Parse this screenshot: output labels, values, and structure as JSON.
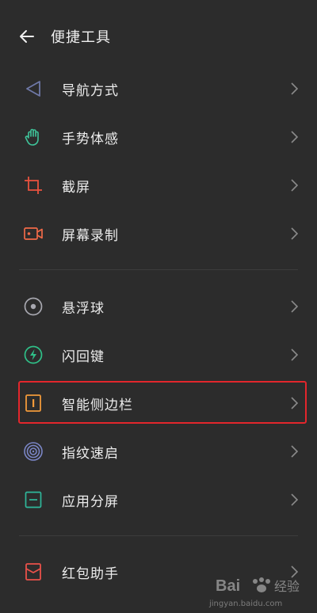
{
  "header": {
    "title": "便捷工具"
  },
  "groups": [
    {
      "items": [
        {
          "label": "导航方式",
          "icon": "navigation-arrow-icon",
          "color": "#6f79a8"
        },
        {
          "label": "手势体感",
          "icon": "hand-gesture-icon",
          "color": "#3fc49a"
        },
        {
          "label": "截屏",
          "icon": "crop-screenshot-icon",
          "color": "#e9523f"
        },
        {
          "label": "屏幕录制",
          "icon": "screen-record-icon",
          "color": "#f06a48"
        }
      ]
    },
    {
      "items": [
        {
          "label": "悬浮球",
          "icon": "floating-ball-icon",
          "color": "#a8a8b0"
        },
        {
          "label": "闪回键",
          "icon": "flash-back-icon",
          "color": "#2fc088"
        },
        {
          "label": "智能侧边栏",
          "icon": "smart-sidebar-icon",
          "color": "#f19a3a",
          "highlighted": true
        },
        {
          "label": "指纹速启",
          "icon": "fingerprint-icon",
          "color": "#7b86c6"
        },
        {
          "label": "应用分屏",
          "icon": "split-screen-icon",
          "color": "#2fb79a"
        }
      ]
    },
    {
      "items": [
        {
          "label": "红包助手",
          "icon": "red-envelope-icon",
          "color": "#e9514a"
        }
      ]
    }
  ],
  "watermark": {
    "brand": "Bai",
    "brand2": "经验",
    "url": "jingyan.baidu.com"
  },
  "highlight_color": "#e3262c"
}
